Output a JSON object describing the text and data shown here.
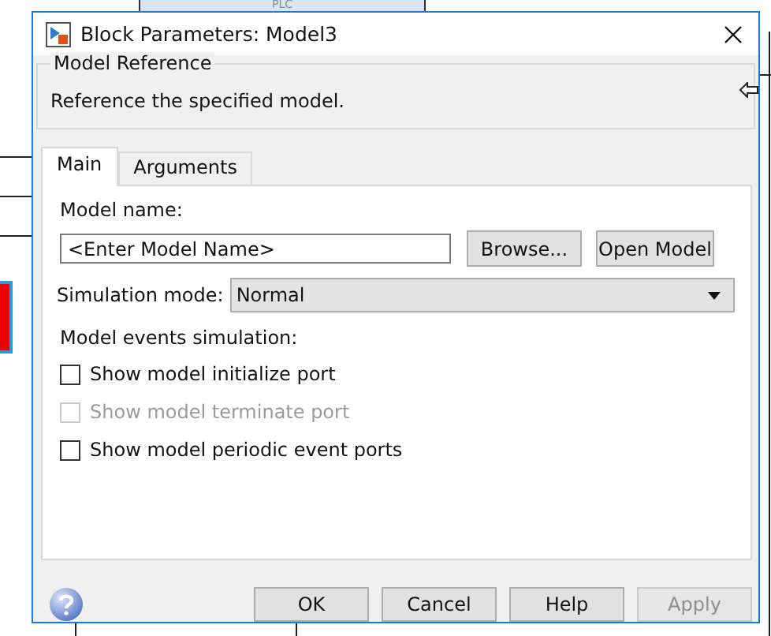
{
  "background": {
    "block_label": "PLC"
  },
  "window": {
    "title": "Block Parameters: Model3"
  },
  "group": {
    "title": "Model Reference",
    "description": "Reference the specified model."
  },
  "tabs": [
    {
      "label": "Main",
      "selected": true
    },
    {
      "label": "Arguments",
      "selected": false
    }
  ],
  "model_name": {
    "label": "Model name:",
    "value": "<Enter Model Name>"
  },
  "model_buttons": [
    {
      "label": "Browse..."
    },
    {
      "label": "Open Model"
    }
  ],
  "simulation_mode": {
    "label": "Simulation mode:",
    "value": "Normal"
  },
  "events": {
    "label": "Model events simulation:",
    "options": [
      {
        "label": "Show model initialize port",
        "checked": false,
        "disabled": false
      },
      {
        "label": "Show model terminate port",
        "checked": false,
        "disabled": true
      },
      {
        "label": "Show model periodic event ports",
        "checked": false,
        "disabled": false
      }
    ]
  },
  "buttons": [
    {
      "label": "OK",
      "disabled": false
    },
    {
      "label": "Cancel",
      "disabled": false
    },
    {
      "label": "Help",
      "disabled": false
    },
    {
      "label": "Apply",
      "disabled": true
    }
  ]
}
